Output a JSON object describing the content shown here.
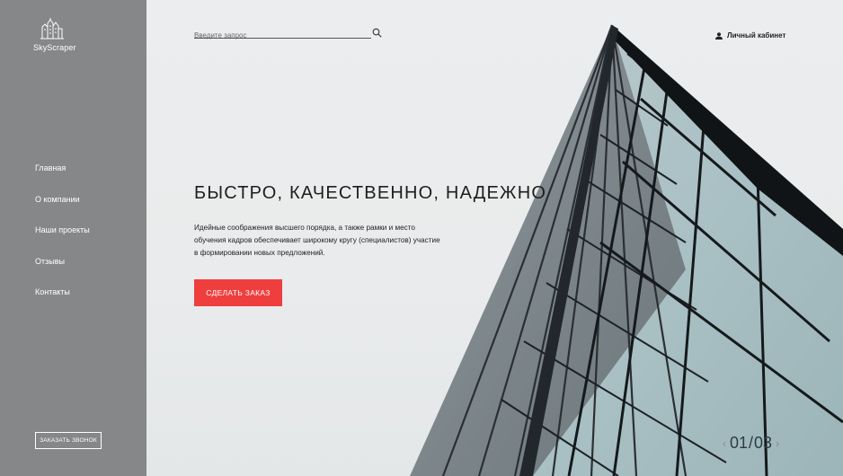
{
  "brand": {
    "name": "SkyScraper"
  },
  "nav": {
    "items": [
      {
        "label": "Главная"
      },
      {
        "label": "О компании"
      },
      {
        "label": "Наши проекты"
      },
      {
        "label": "Отзывы"
      },
      {
        "label": "Контакты"
      }
    ]
  },
  "sidebar": {
    "callback_label": "ЗАКАЗАТЬ ЗВОНОК"
  },
  "search": {
    "placeholder": "Введите запрос",
    "icon": "search-icon"
  },
  "account": {
    "label": "Личный кабинет",
    "icon": "user-icon"
  },
  "hero": {
    "headline": "БЫСТРО, КАЧЕСТВЕННО, НАДЕЖНО",
    "description": "Идейные соображения высшего порядка, а также рамки и место обучения кадров обеспечивает широкому кругу (специалистов) участие в формировании новых предложений.",
    "cta_label": "СДЕЛАТЬ ЗАКАЗ"
  },
  "pager": {
    "current": "01",
    "separator": "/",
    "total": "03"
  },
  "colors": {
    "sidebar": "#868789",
    "accent": "#ef3e3e",
    "text": "#1e1e1e"
  }
}
